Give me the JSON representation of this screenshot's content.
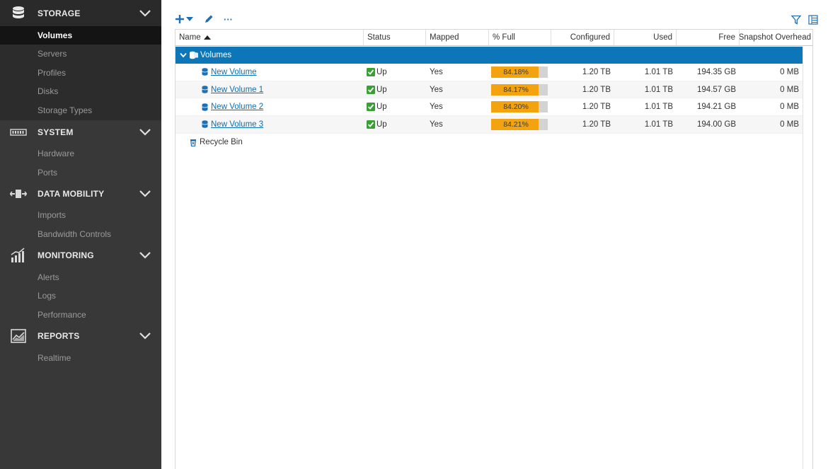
{
  "sidebar": {
    "storage": {
      "label": "STORAGE",
      "icon": "database-icon",
      "items": [
        "Volumes",
        "Servers",
        "Profiles",
        "Disks",
        "Storage Types"
      ],
      "active": "Volumes"
    },
    "system": {
      "label": "SYSTEM",
      "icon": "hardware-icon",
      "items": [
        "Hardware",
        "Ports"
      ]
    },
    "data_mobility": {
      "label": "DATA MOBILITY",
      "icon": "data-mobility-icon",
      "items": [
        "Imports",
        "Bandwidth Controls"
      ]
    },
    "monitoring": {
      "label": "MONITORING",
      "icon": "monitoring-icon",
      "items": [
        "Alerts",
        "Logs",
        "Performance"
      ]
    },
    "reports": {
      "label": "REPORTS",
      "icon": "reports-icon",
      "items": [
        "Realtime"
      ]
    }
  },
  "toolbar": {
    "add_icon": "plus-icon",
    "edit_icon": "pencil-icon",
    "more_label": "···",
    "filter_icon": "filter-icon",
    "columns_icon": "columns-icon"
  },
  "grid": {
    "columns": [
      "Name",
      "Status",
      "Mapped",
      "% Full",
      "Configured",
      "Used",
      "Free",
      "Snapshot Overhead"
    ],
    "group": {
      "label": "Volumes"
    },
    "rows": [
      {
        "name": "New Volume",
        "status": "Up",
        "mapped": "Yes",
        "full_label": "84.18%",
        "full": 84.18,
        "configured": "1.20 TB",
        "used": "1.01 TB",
        "free": "194.35 GB",
        "snapshot": "0 MB"
      },
      {
        "name": "New Volume 1",
        "status": "Up",
        "mapped": "Yes",
        "full_label": "84.17%",
        "full": 84.17,
        "configured": "1.20 TB",
        "used": "1.01 TB",
        "free": "194.57 GB",
        "snapshot": "0 MB"
      },
      {
        "name": "New Volume 2",
        "status": "Up",
        "mapped": "Yes",
        "full_label": "84.20%",
        "full": 84.2,
        "configured": "1.20 TB",
        "used": "1.01 TB",
        "free": "194.21 GB",
        "snapshot": "0 MB"
      },
      {
        "name": "New Volume 3",
        "status": "Up",
        "mapped": "Yes",
        "full_label": "84.21%",
        "full": 84.21,
        "configured": "1.20 TB",
        "used": "1.01 TB",
        "free": "194.00 GB",
        "snapshot": "0 MB"
      }
    ],
    "recycle_bin": "Recycle Bin"
  },
  "colors": {
    "accent": "#0d76b8",
    "bar_fill": "#f2a30f",
    "status_ok": "#3aa035",
    "sidebar_bg": "#383838"
  }
}
